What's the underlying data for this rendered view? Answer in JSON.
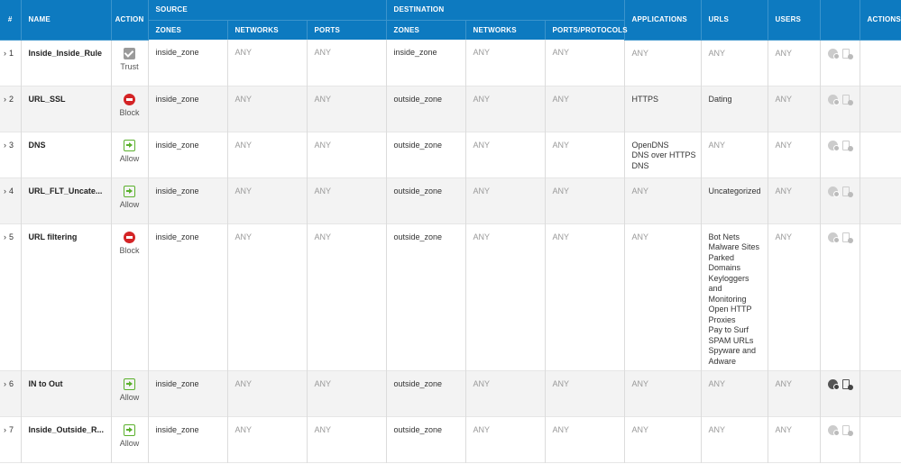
{
  "header": {
    "groups": {
      "source": "SOURCE",
      "destination": "DESTINATION"
    },
    "columns": {
      "num": "#",
      "name": "NAME",
      "action": "ACTION",
      "src_zones": "ZONES",
      "src_networks": "NETWORKS",
      "src_ports": "PORTS",
      "dst_zones": "ZONES",
      "dst_networks": "NETWORKS",
      "dst_ports": "PORTS/PROTOCOLS",
      "applications": "APPLICATIONS",
      "urls": "URLS",
      "users": "USERS",
      "actions": "ACTIONS"
    }
  },
  "rows": [
    {
      "num": "1",
      "name": "Inside_Inside_Rule",
      "action": "Trust",
      "action_icon": "trust-icon",
      "src_zones": "inside_zone",
      "src_networks": "ANY",
      "src_ports": "ANY",
      "dst_zones": "inside_zone",
      "dst_networks": "ANY",
      "dst_ports": "ANY",
      "applications": [
        "ANY"
      ],
      "urls": [
        "ANY"
      ],
      "users": "ANY"
    },
    {
      "num": "2",
      "name": "URL_SSL",
      "action": "Block",
      "action_icon": "block-icon",
      "src_zones": "inside_zone",
      "src_networks": "ANY",
      "src_ports": "ANY",
      "dst_zones": "outside_zone",
      "dst_networks": "ANY",
      "dst_ports": "ANY",
      "applications": [
        "HTTPS"
      ],
      "urls": [
        "Dating"
      ],
      "users": "ANY"
    },
    {
      "num": "3",
      "name": "DNS",
      "action": "Allow",
      "action_icon": "allow-icon",
      "src_zones": "inside_zone",
      "src_networks": "ANY",
      "src_ports": "ANY",
      "dst_zones": "outside_zone",
      "dst_networks": "ANY",
      "dst_ports": "ANY",
      "applications": [
        "OpenDNS",
        "DNS over HTTPS",
        "DNS"
      ],
      "urls": [
        "ANY"
      ],
      "users": "ANY"
    },
    {
      "num": "4",
      "name": "URL_FLT_Uncate...",
      "action": "Allow",
      "action_icon": "allow-icon",
      "src_zones": "inside_zone",
      "src_networks": "ANY",
      "src_ports": "ANY",
      "dst_zones": "outside_zone",
      "dst_networks": "ANY",
      "dst_ports": "ANY",
      "applications": [
        "ANY"
      ],
      "urls": [
        "Uncategorized"
      ],
      "users": "ANY"
    },
    {
      "num": "5",
      "name": "URL filtering",
      "action": "Block",
      "action_icon": "block-icon",
      "src_zones": "inside_zone",
      "src_networks": "ANY",
      "src_ports": "ANY",
      "dst_zones": "outside_zone",
      "dst_networks": "ANY",
      "dst_ports": "ANY",
      "applications": [
        "ANY"
      ],
      "urls": [
        "Bot Nets",
        "Malware Sites",
        "Parked",
        "Domains",
        "Keyloggers",
        "and",
        "Monitoring",
        "Open HTTP",
        "Proxies",
        "Pay to Surf",
        "SPAM URLs",
        "Spyware and",
        "Adware"
      ],
      "users": "ANY"
    },
    {
      "num": "6",
      "name": "IN to Out",
      "action": "Allow",
      "action_icon": "allow-icon",
      "src_zones": "inside_zone",
      "src_networks": "ANY",
      "src_ports": "ANY",
      "dst_zones": "outside_zone",
      "dst_networks": "ANY",
      "dst_ports": "ANY",
      "applications": [
        "ANY"
      ],
      "urls": [
        "ANY"
      ],
      "users": "ANY",
      "options_active": true
    },
    {
      "num": "7",
      "name": "Inside_Outside_R...",
      "action": "Allow",
      "action_icon": "allow-icon",
      "src_zones": "inside_zone",
      "src_networks": "ANY",
      "src_ports": "ANY",
      "dst_zones": "outside_zone",
      "dst_networks": "ANY",
      "dst_ports": "ANY",
      "applications": [
        "ANY"
      ],
      "urls": [
        "ANY"
      ],
      "users": "ANY"
    }
  ],
  "colors": {
    "header_bg": "#0d7ac0",
    "row_alt_bg": "#f3f3f3",
    "block": "#d42426",
    "allow": "#5ab02c",
    "trust": "#9a9a9a"
  }
}
